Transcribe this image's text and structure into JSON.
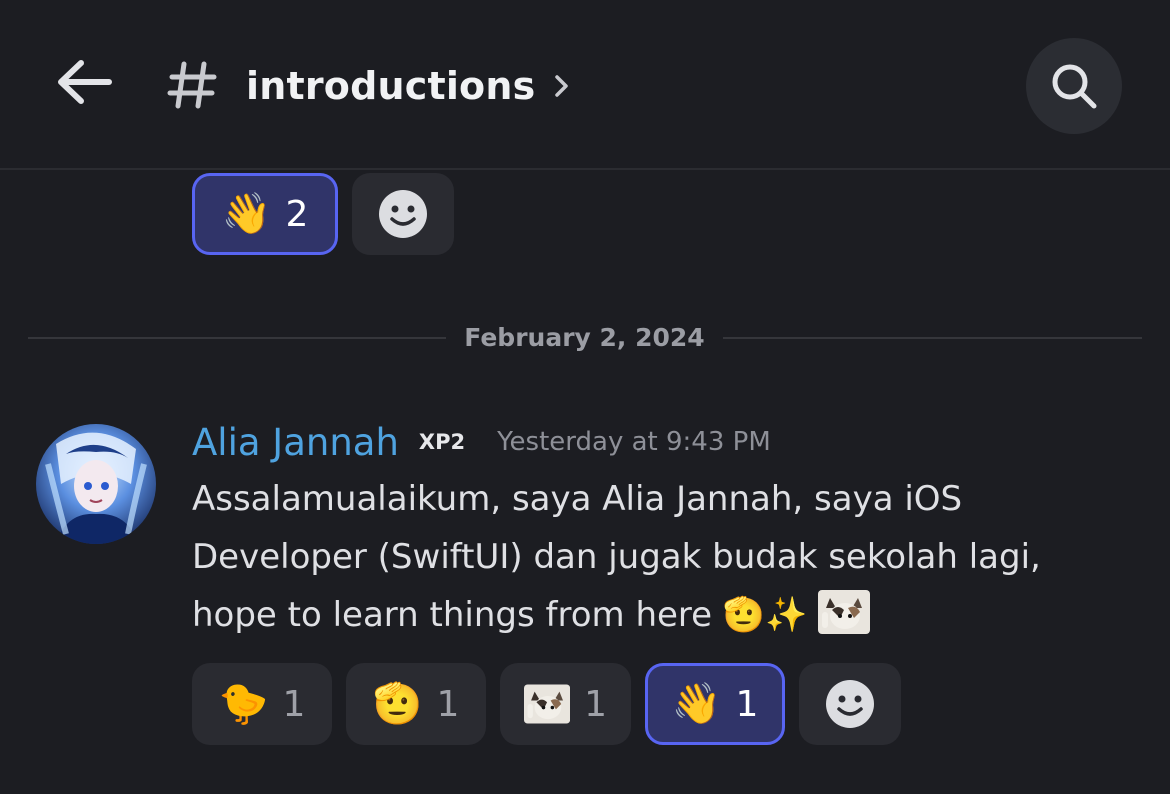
{
  "header": {
    "channel_name": "introductions"
  },
  "top_reactions": [
    {
      "emoji": "👋",
      "count": "2",
      "active": true
    }
  ],
  "date_divider": "February 2, 2024",
  "message": {
    "author": "Alia Jannah",
    "tag": "XP2",
    "timestamp": "Yesterday at 9:43 PM",
    "text": "Assalamualaikum, saya Alia Jannah, saya iOS Developer (SwiftUI) dan jugak budak sekolah lagi, hope to learn things from here",
    "text_emojis": "🫡✨",
    "reactions": [
      {
        "emoji": "🐤",
        "count": "1",
        "active": false
      },
      {
        "emoji": "🫡",
        "count": "1",
        "active": false
      },
      {
        "emoji": "cat-sticker",
        "count": "1",
        "active": false
      },
      {
        "emoji": "👋",
        "count": "1",
        "active": true
      }
    ]
  },
  "colors": {
    "background": "#1c1d22",
    "accent": "#5865f2",
    "username": "#4fa3e0"
  }
}
